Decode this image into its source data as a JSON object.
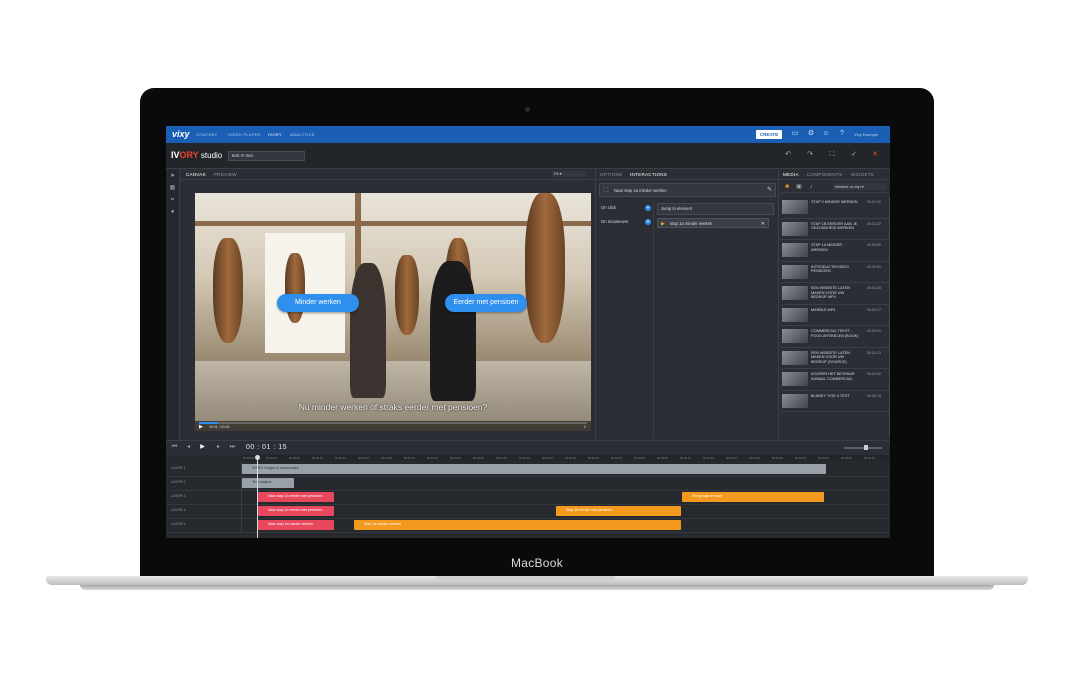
{
  "device": {
    "label": "MacBook"
  },
  "app": {
    "logo": "vixy",
    "nav": [
      "CONTENT",
      "VIDEO PLAYER",
      "IVORY",
      "ANALYTICS"
    ],
    "create_label": "CREATE",
    "user_name": "Vixy Example"
  },
  "studio": {
    "logo_prefix": "IV",
    "logo_highlight": "ORY",
    "logo_suffix": " studio",
    "project_name": "test !!! mei"
  },
  "canvas": {
    "tabs": [
      "CANVAS",
      "PREVIEW"
    ],
    "fit_label": "Fit",
    "hotspots": [
      "Minder werken",
      "Eerder met pensioen"
    ],
    "subtitle": "Nu minder werken of straks eerder met pensioen?",
    "video_time": "00:01 / 00:06",
    "progress": 0.05
  },
  "interactions": {
    "tabs": [
      "OPTIONS",
      "INTERACTIONS"
    ],
    "selected": "Naar stap 1a minder werken",
    "events": [
      "On click",
      "On mouseover"
    ],
    "action": "Jump to element",
    "target": "stap 1a minder werken"
  },
  "media": {
    "tabs": [
      "MEDIA",
      "COMPONENTS",
      "WIDGETS"
    ],
    "sort_label": "Newest on top",
    "items": [
      {
        "title": "STAP 2 MINDER WERKEN",
        "duration": "00:01:10"
      },
      {
        "title": "STAP 1B EERDER AAN JE GEZONDHEID WERKEN",
        "duration": "00:01:22"
      },
      {
        "title": "STAP 1A MINDER WERKEN",
        "duration": "00:00:50"
      },
      {
        "title": "INTRODUCTIEVIDEO PENSIOEN",
        "duration": "00:00:51"
      },
      {
        "title": "EEN WEBSITE LATEN MAKEN VOOR UW BEDRIJF MP4",
        "duration": "00:01:26"
      },
      {
        "title": "MARBLE.MP4",
        "duration": "00:00:17"
      },
      {
        "title": "COMMERCIAL TEKST - FOOD ARTIKELEN (BOOK)",
        "duration": "00:00:31"
      },
      {
        "title": "EEN WEBSITE LATEN MAKEN VOOR UW BEDRIJF (SOURCE)",
        "duration": "00:01:23"
      },
      {
        "title": "KOOPER HET BESPAAR KANAAL COMMERCIAL",
        "duration": "00:00:32"
      },
      {
        "title": "BLANKY TIGE II TEST",
        "duration": "00:00:15"
      }
    ]
  },
  "timeline": {
    "time": "00 : 01 : 15",
    "ticks": [
      "00:00:00",
      "00:00:10",
      "00:00:20",
      "00:00:30",
      "00:00:40",
      "00:00:50",
      "00:01:00",
      "00:01:10",
      "00:01:20",
      "00:01:30",
      "00:01:40",
      "00:01:50",
      "00:02:00",
      "00:02:10",
      "00:02:20",
      "00:02:30",
      "00:02:40",
      "00:02:50",
      "00:03:00",
      "00:03:10",
      "00:03:20",
      "00:03:30",
      "00:03:40",
      "00:03:50",
      "00:04:00",
      "00:04:10",
      "00:04:20",
      "00:04:30"
    ],
    "tracks": [
      {
        "label": "LAYER 1"
      },
      {
        "label": "LAYER 2"
      },
      {
        "label": "LAYER 3"
      },
      {
        "label": "LAYER 4"
      },
      {
        "label": "LAYER 5"
      }
    ],
    "clips": {
      "c1": "INTRO  Vragen & antwoorden",
      "c2": "Text hotspot",
      "c3": "Naar stap 1b eerder met pensioen",
      "c4": "Terug naar de start",
      "c5": "Naar stap 1b eerder met pensioen",
      "c6": "Stap 1b eerder met pensioen",
      "c7": "Naar stap 1a minder werken",
      "c8": "Stap 1a minder werken"
    }
  },
  "colors": {
    "brand": "#1b5fb4",
    "accent": "#2f8fee",
    "red_clip": "#e8475c",
    "orange_clip": "#f39a1e",
    "logo_red": "#e8432e"
  }
}
